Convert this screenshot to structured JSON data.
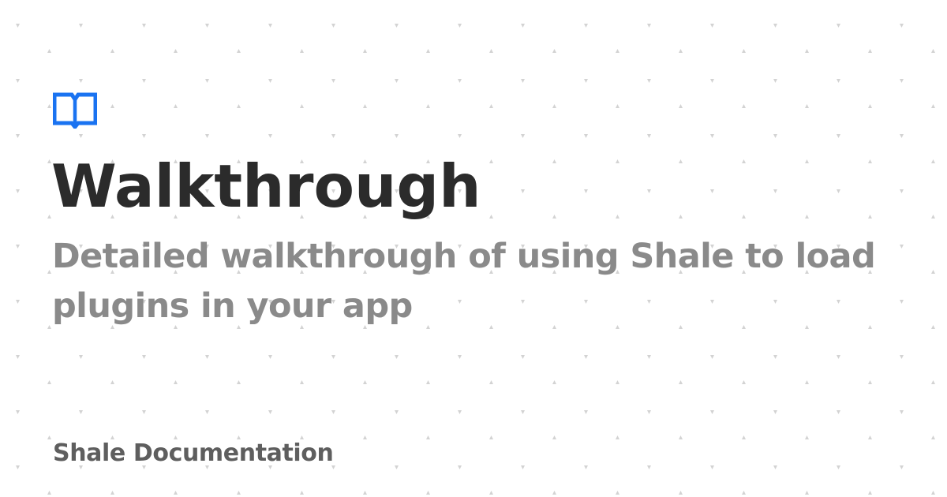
{
  "page": {
    "title": "Walkthrough",
    "subtitle": "Detailed walkthrough of using Shale to load plugins in your app",
    "site_name": "Shale Documentation"
  },
  "icons": {
    "logo": "open-book-icon"
  },
  "colors": {
    "background": "#ffffff",
    "accent": "#1a73f1",
    "title": "#2b2b2b",
    "subtitle": "#8a8a8a",
    "footer": "#5e5e5e",
    "pattern": "#d3d3d3"
  }
}
